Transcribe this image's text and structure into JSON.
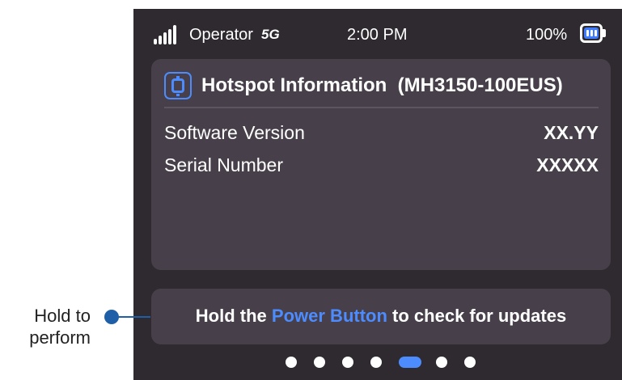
{
  "status_bar": {
    "carrier": "Operator",
    "network": "5G",
    "time": "2:00 PM",
    "battery_percent": "100%",
    "battery_level": 1.0,
    "signal_icon": "signal-bars-icon",
    "battery_icon": "battery-icon"
  },
  "info_card": {
    "icon": "hotspot-icon",
    "title": "Hotspot Information",
    "model": "(MH3150-100EUS)",
    "rows": [
      {
        "label": "Software Version",
        "value": "XX.YY"
      },
      {
        "label": "Serial Number",
        "value": "XXXXX"
      }
    ]
  },
  "hint": {
    "prefix": "Hold the",
    "highlight": "Power Button",
    "suffix": "to check for updates"
  },
  "pagination": {
    "total": 7,
    "current": 5
  },
  "callout": {
    "line1": "Hold to",
    "line2": "perform"
  },
  "colors": {
    "accent": "#4d8cff",
    "screen_background": "#2e2a2f",
    "card_background": "#47404a",
    "callout": "#1f5fa8"
  }
}
